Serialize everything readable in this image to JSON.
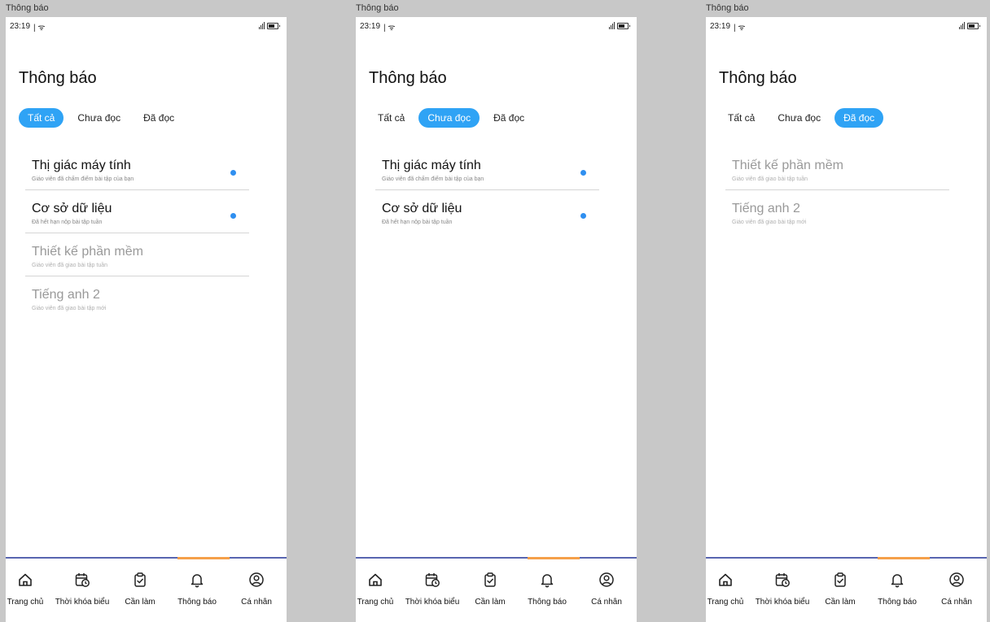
{
  "frames": [
    {
      "label": "Thông báo",
      "status": {
        "time": "23:19"
      },
      "title": "Thông báo",
      "tabs": [
        {
          "label": "Tất cả",
          "active": true
        },
        {
          "label": "Chưa đọc",
          "active": false
        },
        {
          "label": "Đã đọc",
          "active": false
        }
      ],
      "items": [
        {
          "title": "Thị giác máy tính",
          "desc": "Giáo viên đã chấm điểm bài tập của bạn",
          "unread": true
        },
        {
          "title": "Cơ sở dữ liệu",
          "desc": "Đã hết hạn nộp bài tập tuần",
          "unread": true
        },
        {
          "title": "Thiết kế phần mềm",
          "desc": "Giáo viên đã giao bài tập tuần",
          "unread": false
        },
        {
          "title": "Tiếng anh 2",
          "desc": "Giáo viên đã giao bài tập mới",
          "unread": false
        }
      ]
    },
    {
      "label": "Thông báo",
      "status": {
        "time": "23:19"
      },
      "title": "Thông báo",
      "tabs": [
        {
          "label": "Tất cả",
          "active": false
        },
        {
          "label": "Chưa đọc",
          "active": true
        },
        {
          "label": "Đã đọc",
          "active": false
        }
      ],
      "items": [
        {
          "title": "Thị giác máy tính",
          "desc": "Giáo viên đã chấm điểm bài tập của bạn",
          "unread": true
        },
        {
          "title": "Cơ sở dữ liệu",
          "desc": "Đã hết hạn nộp bài tập tuần",
          "unread": true
        }
      ]
    },
    {
      "label": "Thông báo",
      "status": {
        "time": "23:19"
      },
      "title": "Thông báo",
      "tabs": [
        {
          "label": "Tất cả",
          "active": false
        },
        {
          "label": "Chưa đọc",
          "active": false
        },
        {
          "label": "Đã đọc",
          "active": true
        }
      ],
      "items": [
        {
          "title": "Thiết kế phần mềm",
          "desc": "Giáo viên đã giao bài tập tuần",
          "unread": false
        },
        {
          "title": "Tiếng anh 2",
          "desc": "Giáo viên đã giao bài tập mới",
          "unread": false
        }
      ]
    }
  ],
  "bottom_nav": [
    {
      "label": "Trang chủ",
      "icon": "home-icon"
    },
    {
      "label": "Thời khóa biểu",
      "icon": "calendar-clock-icon"
    },
    {
      "label": "Cần làm",
      "icon": "clipboard-check-icon"
    },
    {
      "label": "Thông báo",
      "icon": "bell-icon",
      "active": true
    },
    {
      "label": "Cá nhân",
      "icon": "user-circle-icon"
    }
  ],
  "colors": {
    "accent": "#2fa3f5",
    "unread_dot": "#2f8ff0",
    "nav_border": "#5865b0",
    "nav_indicator": "#f5a04a"
  }
}
